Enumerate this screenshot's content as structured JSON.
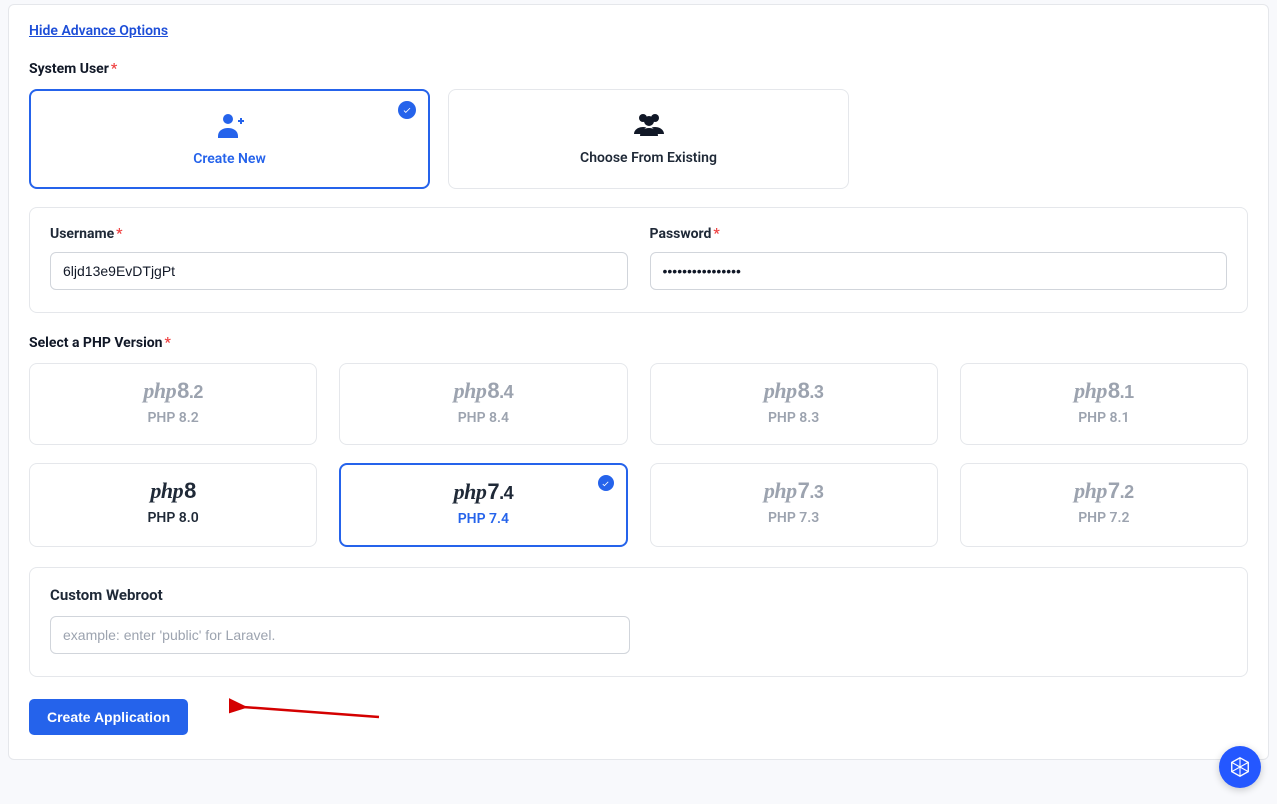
{
  "hide_link": "Hide Advance Options",
  "system_user": {
    "label": "System User",
    "create_new": "Create New",
    "choose_existing": "Choose From Existing"
  },
  "credentials": {
    "username_label": "Username",
    "username_value": "6ljd13e9EvDTjgPt",
    "password_label": "Password",
    "password_value": "••••••••••••••••"
  },
  "php_section_label": "Select a PHP Version",
  "php_versions": [
    {
      "logo_prefix": "php",
      "major": "8",
      "minor": ".2",
      "label": "PHP 8.2",
      "state": "faded"
    },
    {
      "logo_prefix": "php",
      "major": "8",
      "minor": ".4",
      "label": "PHP 8.4",
      "state": "faded"
    },
    {
      "logo_prefix": "php",
      "major": "8",
      "minor": ".3",
      "label": "PHP 8.3",
      "state": "faded"
    },
    {
      "logo_prefix": "php",
      "major": "8",
      "minor": ".1",
      "label": "PHP 8.1",
      "state": "faded"
    },
    {
      "logo_prefix": "php",
      "major": "8",
      "minor": "",
      "label": "PHP 8.0",
      "state": "dark"
    },
    {
      "logo_prefix": "php",
      "major": "7",
      "minor": ".4",
      "label": "PHP 7.4",
      "state": "selected"
    },
    {
      "logo_prefix": "php",
      "major": "7",
      "minor": ".3",
      "label": "PHP 7.3",
      "state": "faded"
    },
    {
      "logo_prefix": "php",
      "major": "7",
      "minor": ".2",
      "label": "PHP 7.2",
      "state": "faded"
    }
  ],
  "webroot": {
    "label": "Custom Webroot",
    "placeholder": "example: enter 'public' for Laravel."
  },
  "submit_label": "Create Application"
}
